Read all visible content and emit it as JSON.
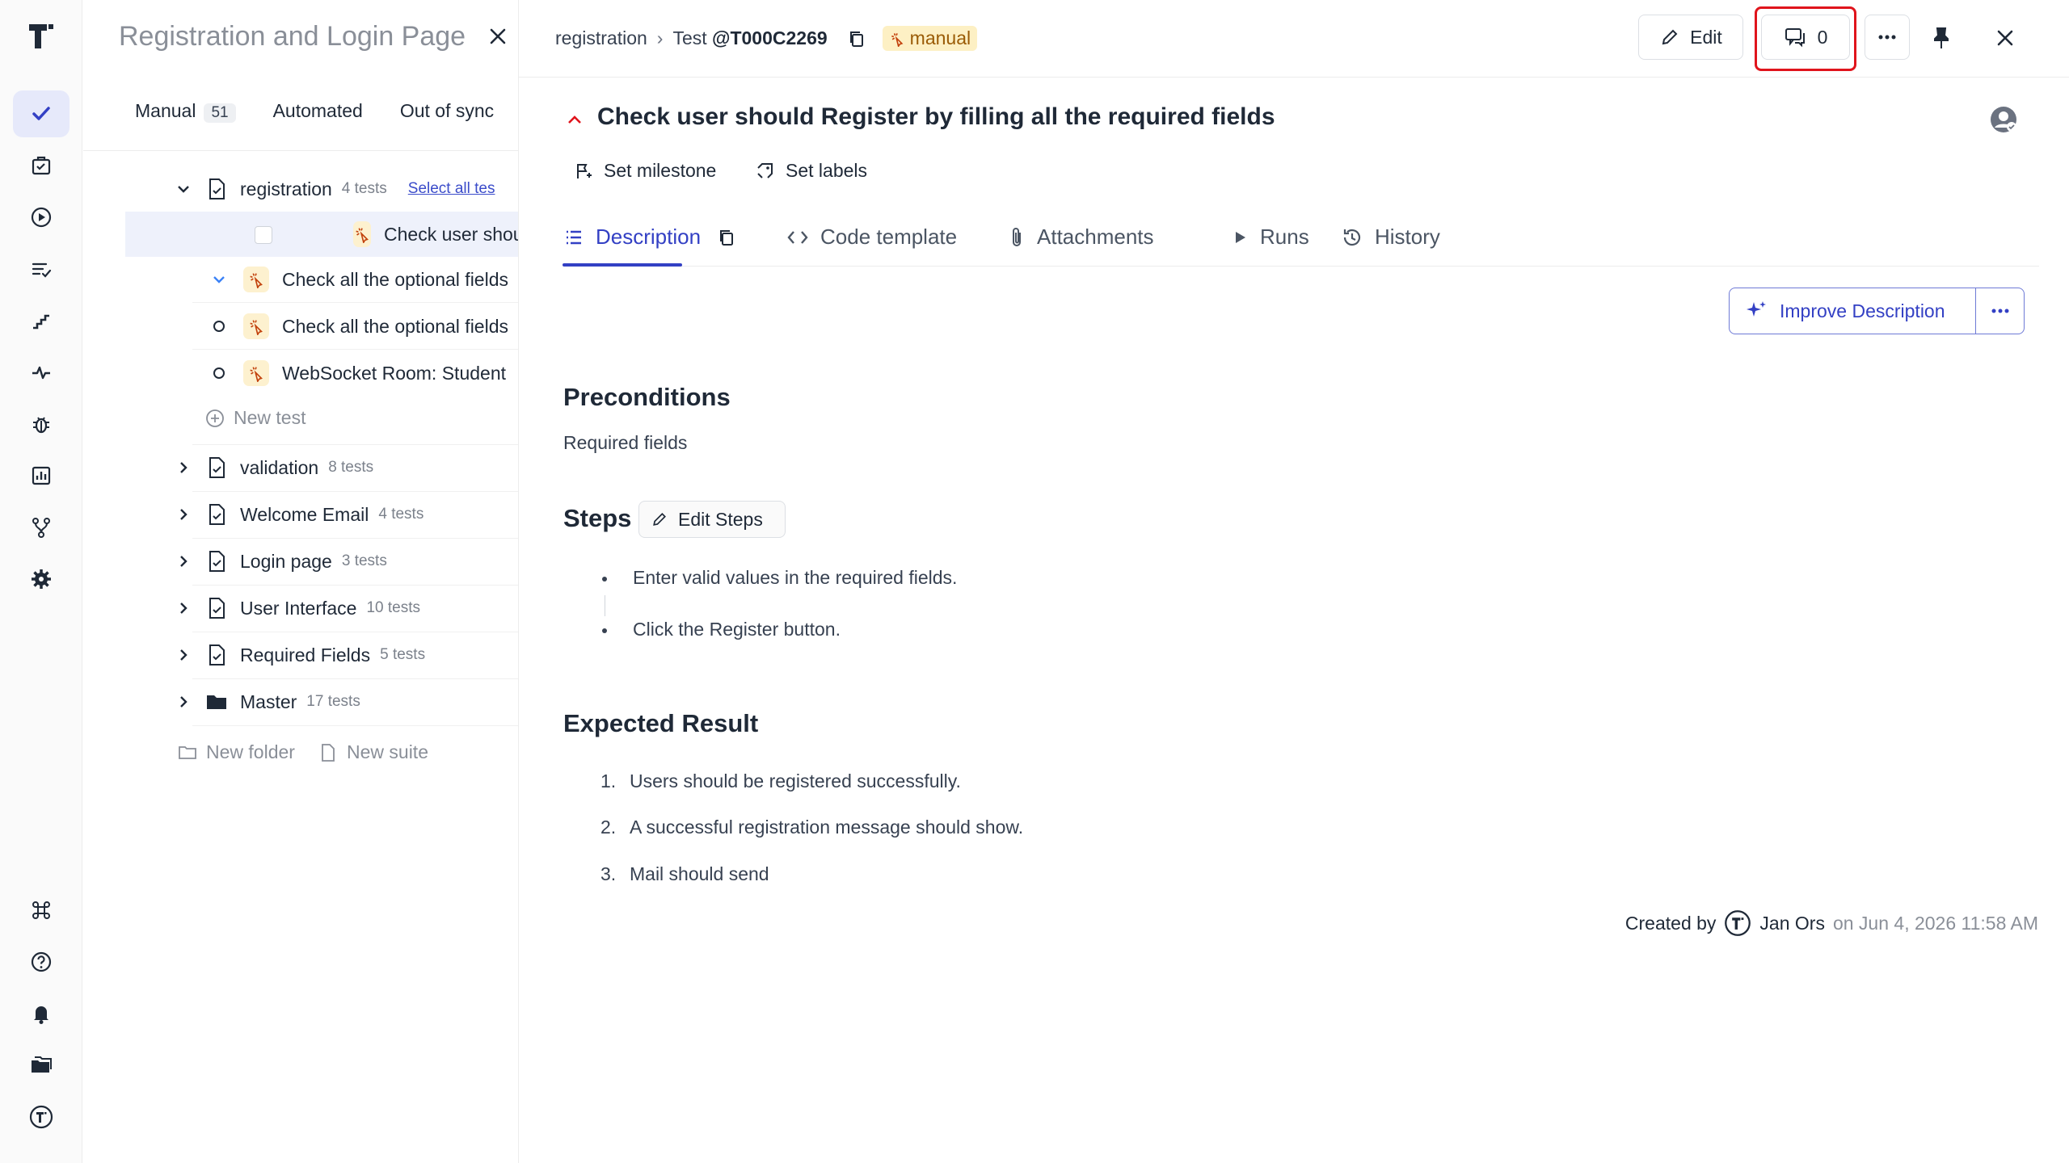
{
  "colors": {
    "accent": "#3340c4",
    "manual_badge_bg": "#fdf0c4",
    "highlight": "#e0141c",
    "danger_chevron": "#e0141c"
  },
  "rail": {
    "items": [
      "check-icon",
      "briefcase-icon",
      "play-circle-icon",
      "list-check-icon",
      "steps-icon",
      "pulse-icon",
      "bug-icon",
      "chart-icon",
      "branch-icon",
      "gear-icon"
    ],
    "bottom": [
      "command-icon",
      "help-icon",
      "bell-icon",
      "folders-icon",
      "logo-icon"
    ]
  },
  "tree": {
    "title": "Registration and Login Page",
    "tabs": [
      {
        "label": "Manual",
        "count": "51"
      },
      {
        "label": "Automated"
      },
      {
        "label": "Out of sync"
      }
    ],
    "suite": {
      "name": "registration",
      "count": "4 tests",
      "select_all": "Select all tes"
    },
    "tests": [
      "Check user should Register",
      "Check all the optional fields",
      "Check all the optional fields",
      "WebSocket Room: Student"
    ],
    "new_test": "New test",
    "suites": [
      {
        "name": "validation",
        "count": "8 tests"
      },
      {
        "name": "Welcome Email",
        "count": "4 tests"
      },
      {
        "name": "Login page",
        "count": "3 tests"
      },
      {
        "name": "User Interface",
        "count": "10 tests"
      },
      {
        "name": "Required Fields",
        "count": "5 tests"
      },
      {
        "name": "Master",
        "count": "17 tests"
      }
    ],
    "new_folder": "New folder",
    "new_suite": "New suite"
  },
  "header": {
    "crumb_suite": "registration",
    "crumb_test_prefix": "Test",
    "crumb_test_id": "@T000C2269",
    "badge": "manual",
    "edit_label": "Edit",
    "comments_count": "0"
  },
  "test": {
    "title": "Check user should Register by filling all the required fields",
    "set_milestone": "Set milestone",
    "set_labels": "Set labels"
  },
  "tabs": {
    "description": "Description",
    "code_template": "Code template",
    "attachments": "Attachments",
    "runs": "Runs",
    "history": "History"
  },
  "improve_label": "Improve Description",
  "content": {
    "preconditions_title": "Preconditions",
    "preconditions_text": "Required fields",
    "steps_title": "Steps",
    "edit_steps": "Edit Steps",
    "steps": [
      "Enter valid values in the required fields.",
      "Click the Register button."
    ],
    "expected_title": "Expected Result",
    "expected": [
      {
        "n": "1.",
        "text": "Users should be registered successfully."
      },
      {
        "n": "2.",
        "text": "A successful registration message should show."
      },
      {
        "n": "3.",
        "text": "Mail should send"
      }
    ]
  },
  "footer": {
    "created_by": "Created by",
    "author": "Jan Ors",
    "date": "on Jun 4, 2026 11:58 AM"
  }
}
